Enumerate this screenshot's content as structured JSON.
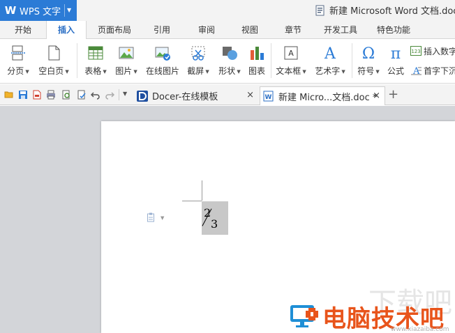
{
  "app": {
    "name": "WPS 文字",
    "document_title": "新建 Microsoft Word 文档.doc"
  },
  "ribbon_tabs": [
    "开始",
    "插入",
    "页面布局",
    "引用",
    "审阅",
    "视图",
    "章节",
    "开发工具",
    "特色功能"
  ],
  "active_tab": "插入",
  "ribbon": {
    "page_break": "分页",
    "blank_page": "空白页",
    "table": "表格",
    "picture": "图片",
    "online_picture": "在线图片",
    "screenshot": "截屏",
    "shapes": "形状",
    "chart": "图表",
    "text_box": "文本框",
    "word_art": "艺术字",
    "symbol": "符号",
    "formula": "公式",
    "insert_number": "插入数字",
    "drop_cap": "首字下沉"
  },
  "doc_tabs": [
    {
      "label": "Docer-在线模板"
    },
    {
      "label": "新建 Micro...文档.doc *"
    }
  ],
  "document": {
    "fraction_numerator": "2",
    "fraction_denominator": "3"
  },
  "watermark": {
    "text": "电脑技术吧",
    "ghost": "下载吧",
    "site": "www.xiazaiba.com"
  },
  "colors": {
    "accent": "#2b7bd6",
    "active_tab_text": "#2b6fc5",
    "workspace": "#d3d5d9",
    "watermark": "#e8541b"
  }
}
